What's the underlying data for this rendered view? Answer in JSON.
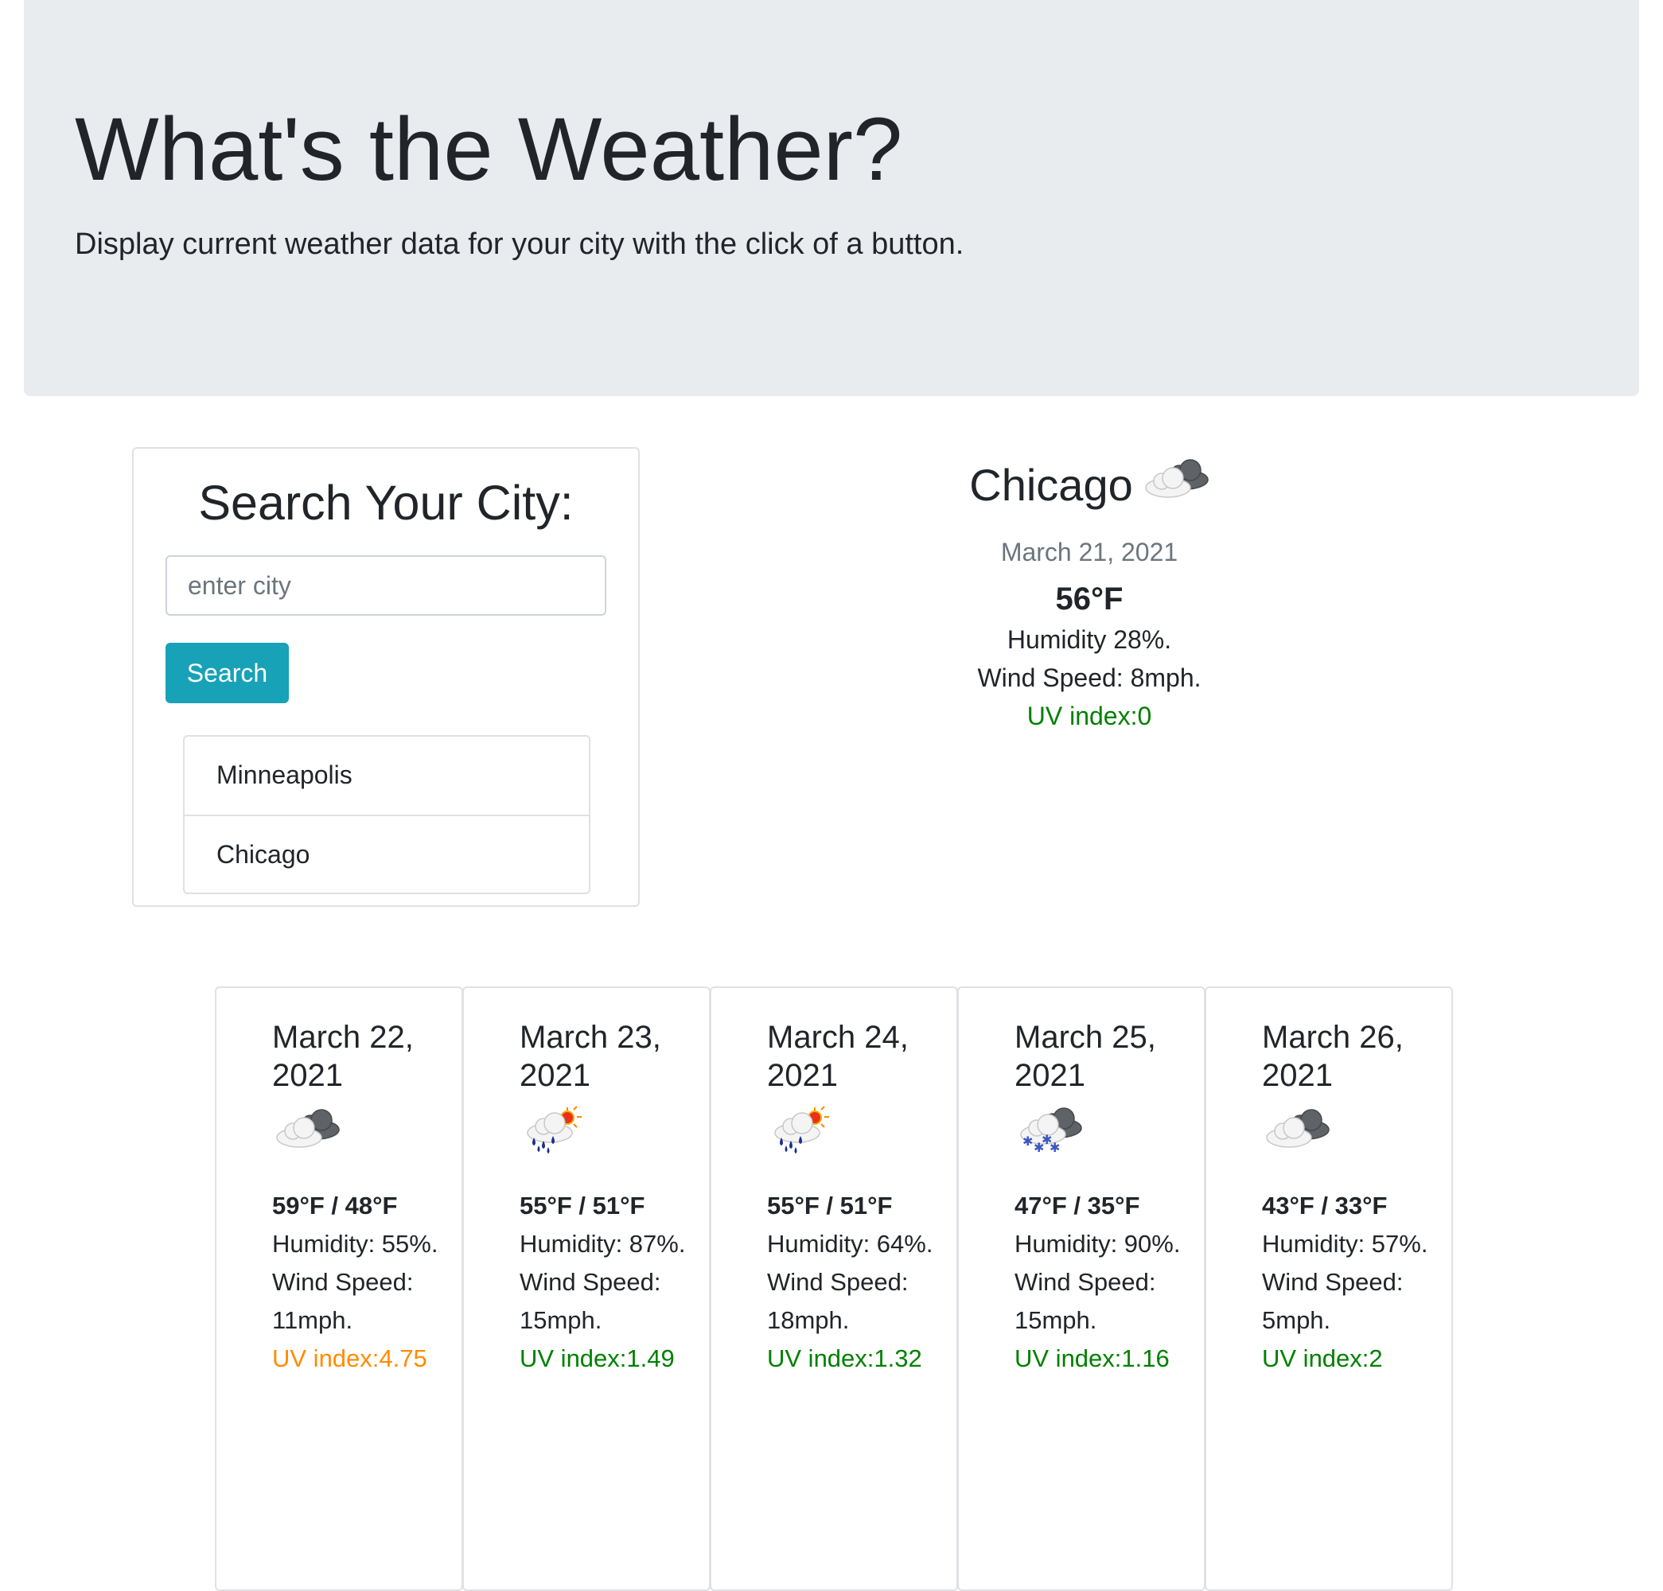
{
  "header": {
    "title": "What's the Weather?",
    "lead": "Display current weather data for your city with the click of a button."
  },
  "search": {
    "title": "Search Your City:",
    "placeholder": "enter city",
    "value": "",
    "button_label": "Search",
    "history": [
      "Minneapolis",
      "Chicago"
    ]
  },
  "current": {
    "city": "Chicago",
    "icon": "partly-cloudy-icon",
    "date": "March 21, 2021",
    "temp": "56°F",
    "humidity": "Humidity 28%.",
    "wind": "Wind Speed: 8mph.",
    "uv": "UV index:0"
  },
  "colors": {
    "uv_low": "#008000",
    "uv_moderate": "#ff8c00",
    "button": "#17a2b8",
    "jumbotron": "#e9ecef"
  },
  "forecast": [
    {
      "date": "March 22, 2021",
      "icon": "cloudy-icon",
      "temp": "59°F / 48°F",
      "humidity": "Humidity: 55%.",
      "wind": "Wind Speed: 11mph.",
      "uv": "UV index:4.75",
      "uv_level": "moderate"
    },
    {
      "date": "March 23, 2021",
      "icon": "rain-sun-icon",
      "temp": "55°F / 51°F",
      "humidity": "Humidity: 87%.",
      "wind": "Wind Speed: 15mph.",
      "uv": "UV index:1.49",
      "uv_level": "low"
    },
    {
      "date": "March 24, 2021",
      "icon": "rain-sun-icon",
      "temp": "55°F / 51°F",
      "humidity": "Humidity: 64%.",
      "wind": "Wind Speed: 18mph.",
      "uv": "UV index:1.32",
      "uv_level": "low"
    },
    {
      "date": "March 25, 2021",
      "icon": "snow-icon",
      "temp": "47°F / 35°F",
      "humidity": "Humidity: 90%.",
      "wind": "Wind Speed: 15mph.",
      "uv": "UV index:1.16",
      "uv_level": "low"
    },
    {
      "date": "March 26, 2021",
      "icon": "cloudy-icon",
      "temp": "43°F / 33°F",
      "humidity": "Humidity: 57%.",
      "wind": "Wind Speed: 5mph.",
      "uv": "UV index:2",
      "uv_level": "low"
    }
  ]
}
